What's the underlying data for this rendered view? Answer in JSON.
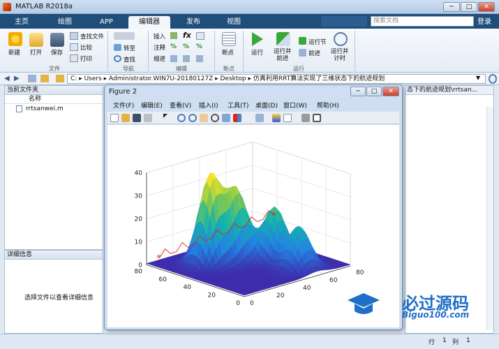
{
  "window": {
    "title": "MATLAB R2018a"
  },
  "tabs": [
    {
      "label": "主页",
      "active": false
    },
    {
      "label": "绘图",
      "active": false
    },
    {
      "label": "APP",
      "active": false
    },
    {
      "label": "编辑器",
      "active": true
    },
    {
      "label": "发布",
      "active": false
    },
    {
      "label": "视图",
      "active": false
    }
  ],
  "search": {
    "placeholder": "搜索文档"
  },
  "login": "登录",
  "ribbon": {
    "file": {
      "new": "新建",
      "open": "打开",
      "save": "保存",
      "find_files": "查找文件",
      "compare": "比较",
      "print": "打印",
      "group": "文件"
    },
    "nav": {
      "goto": "转至",
      "find": "查找",
      "group": "导航"
    },
    "edit": {
      "insert": "插入",
      "comment": "注释",
      "indent": "缩进",
      "fx": "fx",
      "group": "编辑"
    },
    "breakpoints": {
      "label": "断点",
      "group": "断点"
    },
    "run": {
      "run": "运行",
      "run_advance": "运行并\n前进",
      "run_section": "运行节",
      "advance": "前进",
      "run_time": "运行并\n计时",
      "group": "运行"
    }
  },
  "path": {
    "segments": [
      "C:",
      "Users",
      "Administrator.WIN7U-20180127Z",
      "Desktop",
      "仿真利用RRT算法实现了三维状态下的航迹规划"
    ],
    "separator": "▸"
  },
  "current_folder": {
    "title": "当前文件夹",
    "column": "名称",
    "files": [
      "rrtsanwei.m"
    ]
  },
  "details": {
    "title": "详细信息",
    "message": "选择文件以查看详细信息"
  },
  "editor_tab": "态下的航迹规划\\rrtsan...",
  "statusbar": {
    "row_label": "行",
    "row": "1",
    "col_label": "列",
    "col": "1"
  },
  "figure": {
    "title": "Figure 2",
    "menu": [
      "文件(F)",
      "编辑(E)",
      "查看(V)",
      "插入(I)",
      "工具(T)",
      "桌面(D)",
      "窗口(W)",
      "帮助(H)"
    ]
  },
  "watermark": {
    "brand": "必过源码",
    "url": "Biguo100.com"
  },
  "colors": {
    "tabbar": "#1f4e7a",
    "surface_low": "#3b3ba8",
    "surface_high": "#f4e23a",
    "path_line": "#e0241b"
  },
  "chart_data": {
    "type": "surface",
    "title": "",
    "zlim": [
      0,
      40
    ],
    "zticks": [
      0,
      10,
      20,
      30,
      40
    ],
    "xticks": [
      0,
      20,
      40,
      60,
      80
    ],
    "yticks": [
      0,
      20,
      40,
      60,
      80
    ],
    "xlim": [
      0,
      80
    ],
    "ylim": [
      0,
      80
    ],
    "grid": true,
    "peaks": [
      {
        "x": 25,
        "y": 55,
        "height": 38,
        "color": "yellow"
      },
      {
        "x": 40,
        "y": 50,
        "height": 30,
        "color": "yellow-green"
      },
      {
        "x": 55,
        "y": 35,
        "height": 23,
        "color": "green"
      },
      {
        "x": 55,
        "y": 15,
        "height": 18,
        "color": "teal"
      }
    ],
    "path": {
      "start": [
        5,
        75,
        3
      ],
      "end": [
        78,
        60,
        12
      ],
      "marker": "*"
    }
  }
}
